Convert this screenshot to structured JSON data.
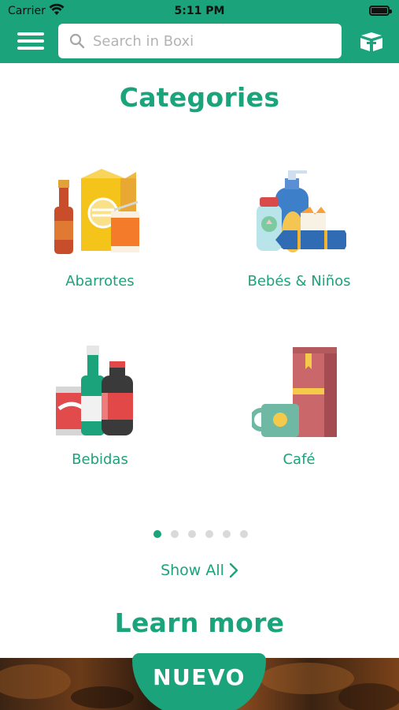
{
  "status_bar": {
    "carrier": "Carrier",
    "time": "5:11 PM"
  },
  "header": {
    "search_placeholder": "Search in Boxi",
    "icons": {
      "menu": "hamburger-menu-icon",
      "search": "magnifier-icon",
      "box": "box-icon"
    }
  },
  "categories": {
    "title": "Categories",
    "items": [
      {
        "label": "Abarrotes",
        "icon": "groceries-illustration"
      },
      {
        "label": "Bebés & Niños",
        "icon": "baby-products-illustration"
      },
      {
        "label": "Bebidas",
        "icon": "drinks-illustration"
      },
      {
        "label": "Café",
        "icon": "coffee-illustration"
      }
    ],
    "pager": {
      "total": 6,
      "active": 1
    },
    "show_all": "Show All"
  },
  "learn_more": {
    "title": "Learn more",
    "badge": "NUEVO"
  },
  "colors": {
    "brand_green": "#1ba37b",
    "inactive_dot": "#d9d9d9"
  }
}
